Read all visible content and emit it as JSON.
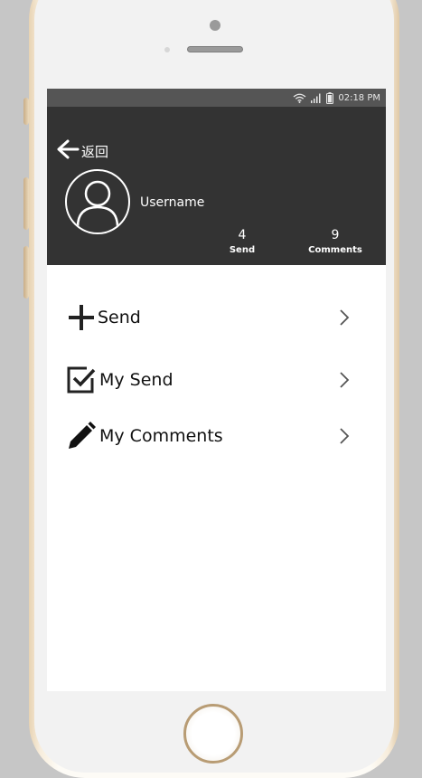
{
  "status_bar": {
    "time": "02:18 PM",
    "icons": [
      "wifi-icon",
      "signal-icon",
      "battery-icon"
    ]
  },
  "header": {
    "back_label": "返回",
    "username": "Username",
    "stats": [
      {
        "value": "4",
        "label": "Send"
      },
      {
        "value": "9",
        "label": "Comments"
      }
    ]
  },
  "menu": {
    "items": [
      {
        "label": "Send",
        "icon": "plus-icon"
      },
      {
        "label": "My Send",
        "icon": "checkbox-icon"
      },
      {
        "label": "My Comments",
        "icon": "pencil-icon"
      }
    ]
  },
  "colors": {
    "header_bg": "#333333",
    "status_bg": "#555555",
    "screen_bg": "#ffffff",
    "frame_gold": "#e8d3b3"
  }
}
